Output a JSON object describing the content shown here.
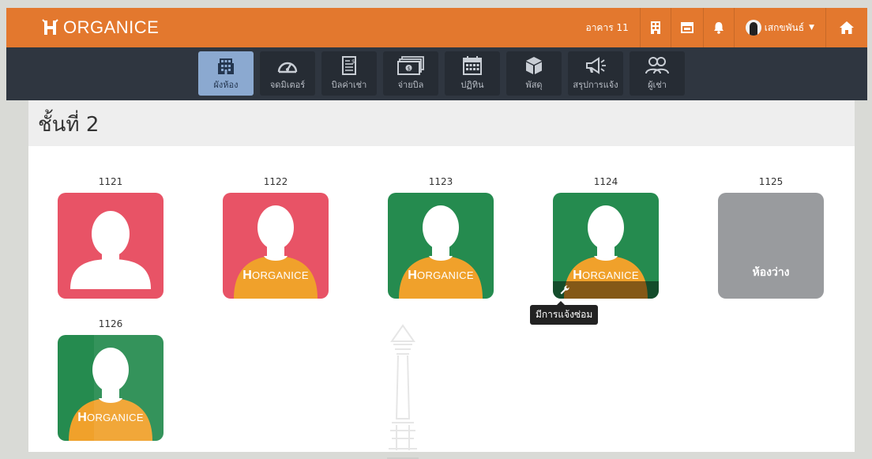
{
  "brand": {
    "name": "ORGANICE",
    "logo_letter": "H"
  },
  "topbar": {
    "building_label": "อาคาร 11",
    "building_icon": "building-icon",
    "calendar_icon": "window-icon",
    "bell_icon": "bell-icon",
    "user_name": "เสกขพันธ์",
    "home_icon": "home-icon"
  },
  "nav": {
    "items": [
      {
        "label": "ผังห้อง",
        "icon": "building-grid-icon",
        "active": true
      },
      {
        "label": "จดมิเตอร์",
        "icon": "speedometer-icon",
        "active": false
      },
      {
        "label": "บิลค่าเช่า",
        "icon": "invoice-icon",
        "active": false
      },
      {
        "label": "จ่ายบิล",
        "icon": "money-icon",
        "active": false
      },
      {
        "label": "ปฏิทิน",
        "icon": "calendar-icon",
        "active": false
      },
      {
        "label": "พัสดุ",
        "icon": "package-icon",
        "active": false
      },
      {
        "label": "สรุปการแจ้ง",
        "icon": "megaphone-icon",
        "active": false
      },
      {
        "label": "ผู้เช่า",
        "icon": "users-icon",
        "active": false
      }
    ]
  },
  "floor": {
    "title": "ชั้นที่ 2"
  },
  "rooms": [
    {
      "number": "1121",
      "status": "occupied-unpaid",
      "color": "#e85366",
      "shirt": false
    },
    {
      "number": "1122",
      "status": "occupied-unpaid",
      "color": "#e85366",
      "shirt": true,
      "shirt_text": "ORGANICE",
      "shirt_letter": "H"
    },
    {
      "number": "1123",
      "status": "occupied-paid",
      "color": "#258b4f",
      "shirt": true,
      "shirt_text": "ORGANICE",
      "shirt_letter": "H"
    },
    {
      "number": "1124",
      "status": "occupied-paid",
      "color": "#258b4f",
      "shirt": true,
      "shirt_text": "ORGANICE",
      "shirt_letter": "H",
      "repair": true
    },
    {
      "number": "1125",
      "status": "vacant",
      "color": "#999b9e",
      "vacant_label": "ห้องว่าง"
    },
    {
      "number": "1126",
      "status": "occupied-paid",
      "color": "#258b4f",
      "shirt": true,
      "shirt_text": "ORGANICE",
      "shirt_letter": "H"
    }
  ],
  "tooltip": {
    "text": "มีการแจ้งซ่อม"
  },
  "colors": {
    "orange": "#e3782e",
    "navy": "#2f3640",
    "red": "#e85366",
    "green": "#258b4f",
    "gray": "#999b9e",
    "shirt": "#f0a12b"
  }
}
